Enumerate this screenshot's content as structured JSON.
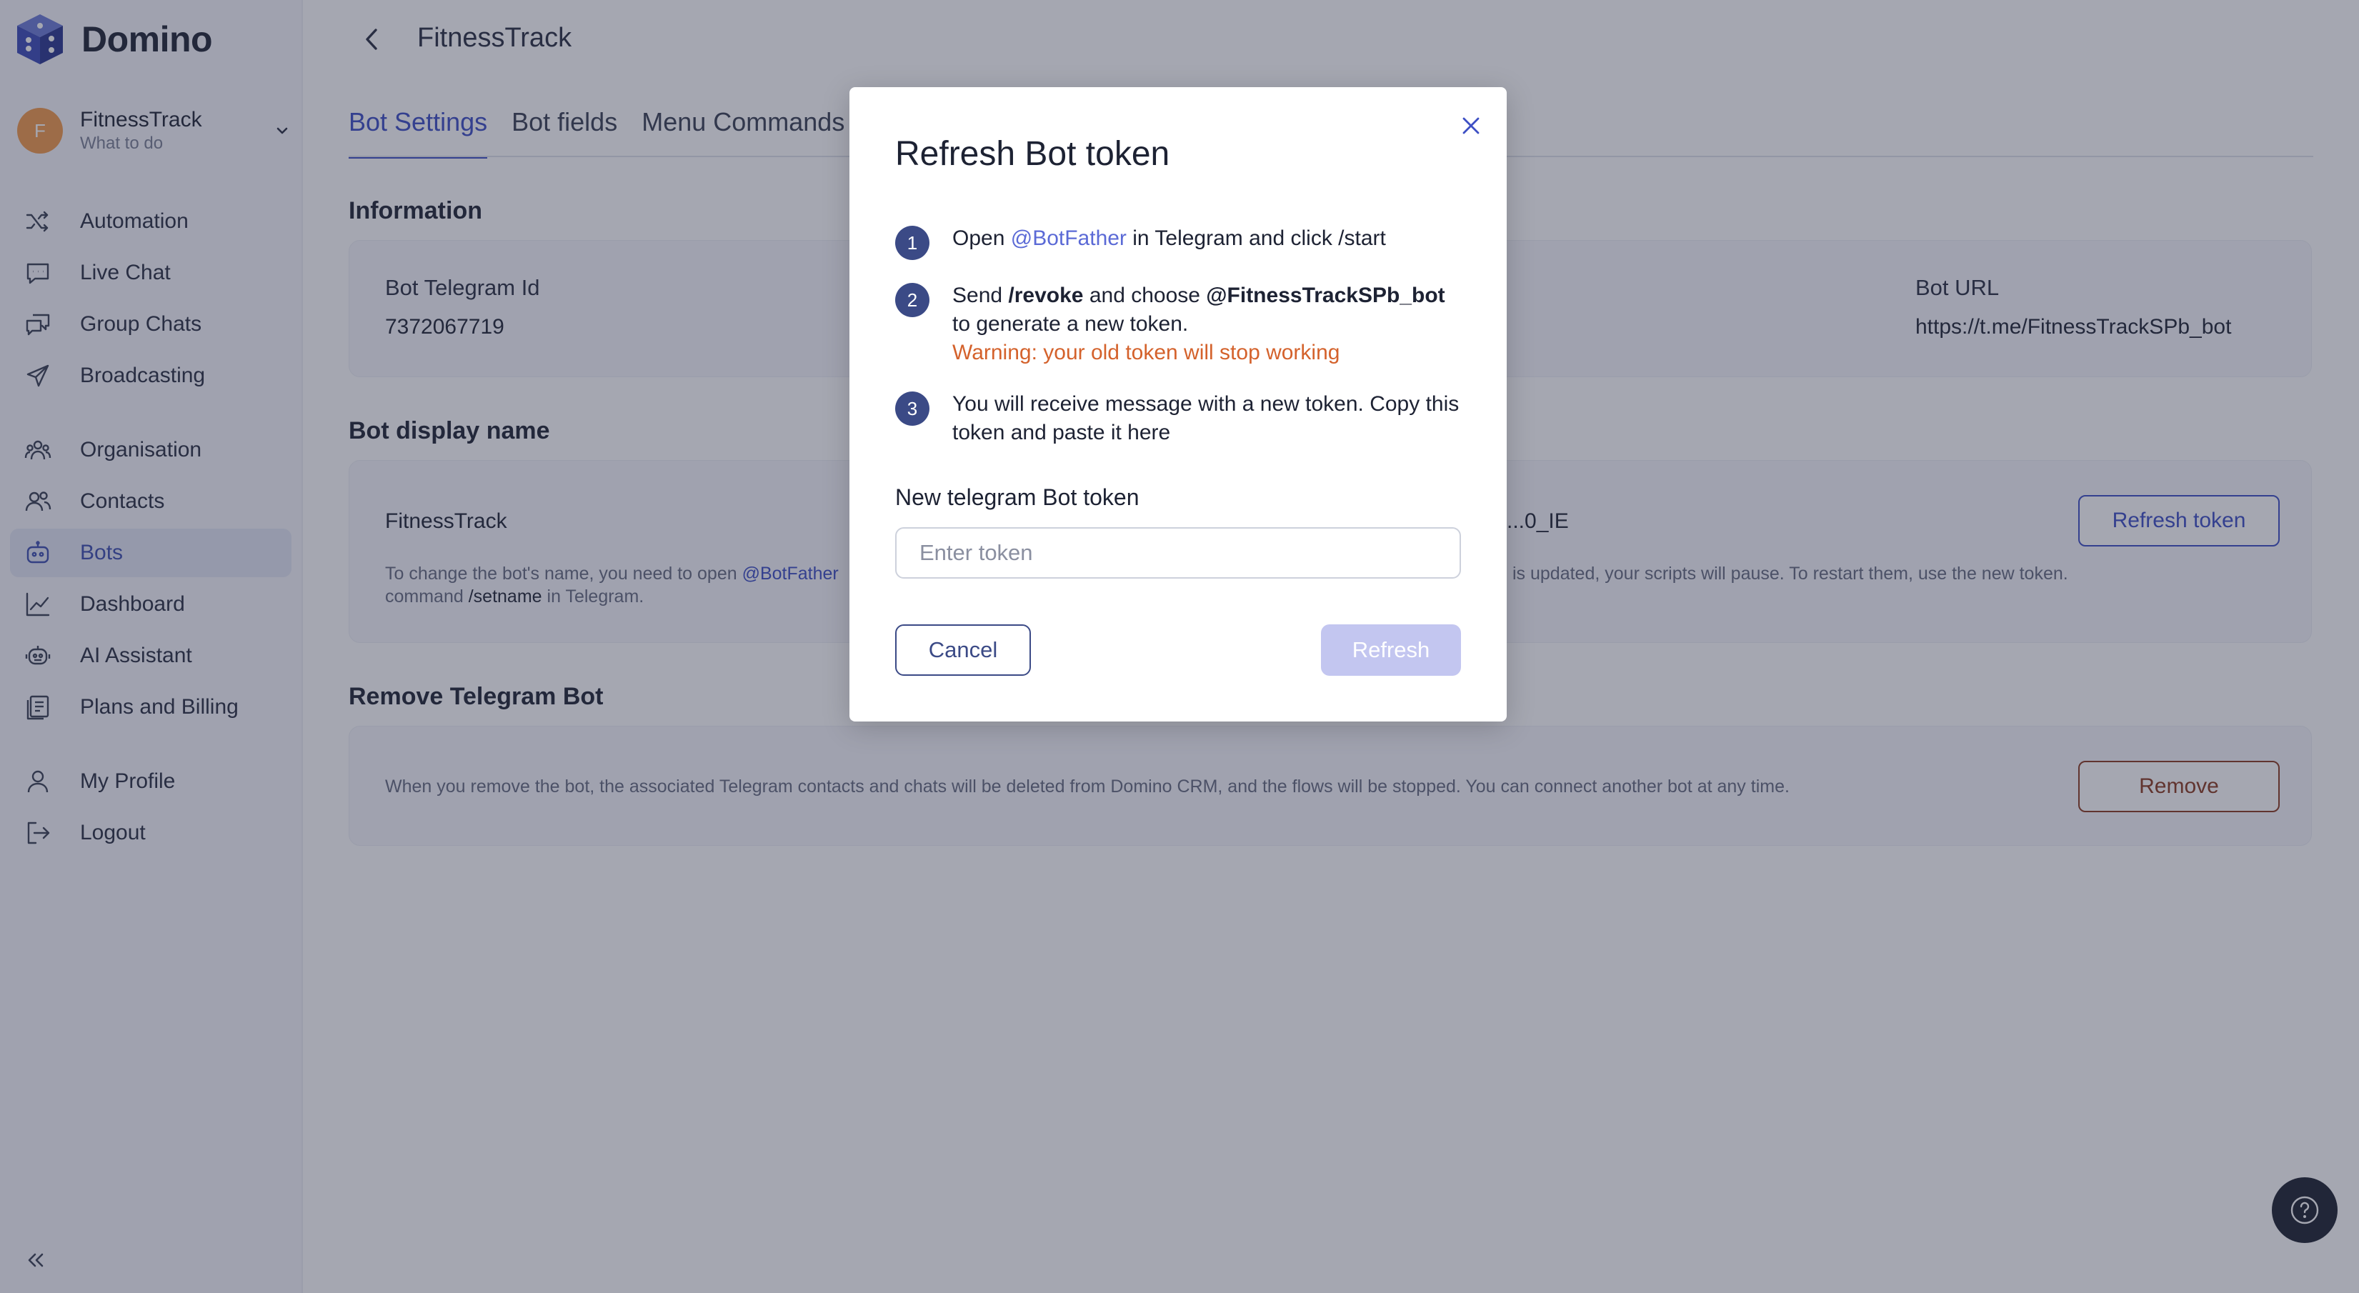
{
  "app": {
    "name": "Domino"
  },
  "workspace": {
    "avatar_letter": "F",
    "name": "FitnessTrack",
    "subtitle": "What to do"
  },
  "sidebar": {
    "items": [
      {
        "label": "Automation",
        "icon": "shuffle-icon"
      },
      {
        "label": "Live Chat",
        "icon": "chat-icon"
      },
      {
        "label": "Group Chats",
        "icon": "group-chat-icon"
      },
      {
        "label": "Broadcasting",
        "icon": "send-icon"
      },
      {
        "label": "Organisation",
        "icon": "organisation-icon"
      },
      {
        "label": "Contacts",
        "icon": "contacts-icon"
      },
      {
        "label": "Bots",
        "icon": "bot-icon",
        "active": true
      },
      {
        "label": "Dashboard",
        "icon": "chart-icon"
      },
      {
        "label": "AI Assistant",
        "icon": "robot-icon"
      },
      {
        "label": "Plans and Billing",
        "icon": "billing-icon"
      },
      {
        "label": "My Profile",
        "icon": "user-icon"
      },
      {
        "label": "Logout",
        "icon": "logout-icon"
      }
    ]
  },
  "header": {
    "title": "FitnessTrack"
  },
  "tabs": [
    {
      "label": "Bot Settings",
      "active": true
    },
    {
      "label": "Bot fields"
    },
    {
      "label": "Menu Commands"
    }
  ],
  "information": {
    "title": "Information",
    "bot_id_label": "Bot Telegram Id",
    "bot_id_value": "7372067719",
    "bot_url_label": "Bot URL",
    "bot_url_value": "https://t.me/FitnessTrackSPb_bot"
  },
  "display_name": {
    "title": "Bot display name",
    "name_value": "FitnessTrack",
    "help_prefix": "To change the bot's name, you need to open ",
    "help_link": "@BotFather",
    "help_line2_prefix": "command ",
    "help_line2_cmd": "/setname",
    "help_line2_suffix": " in Telegram.",
    "token_value": "...0_IE",
    "token_help": "is updated, your scripts will pause. To restart them, use the new token.",
    "refresh_token_label": "Refresh token"
  },
  "remove_bot": {
    "title": "Remove Telegram Bot",
    "description": "When you remove the bot, the associated Telegram contacts and chats will be deleted from Domino CRM, and the flows will be stopped. You can connect another bot at any time.",
    "remove_label": "Remove"
  },
  "modal": {
    "title": "Refresh Bot token",
    "steps": [
      {
        "num": "1",
        "before": "Open ",
        "link": "@BotFather",
        "after": " in Telegram and click /start"
      },
      {
        "num": "2",
        "before": "Send ",
        "cmd": "/revoke",
        "middle": " and choose ",
        "bot": "@FitnessTrackSPb_bot",
        "after": " to generate a new token.",
        "warning": "Warning: your old token will stop working"
      },
      {
        "num": "3",
        "text": "You will receive message with a new token. Copy this token and paste it here"
      }
    ],
    "token_label": "New telegram Bot token",
    "token_placeholder": "Enter token",
    "token_value": "",
    "cancel_label": "Cancel",
    "refresh_label": "Refresh"
  },
  "colors": {
    "accent": "#3d4fc4",
    "modal_step": "#3b4a86",
    "warning": "#d4622c",
    "danger": "#8a3a1f"
  }
}
